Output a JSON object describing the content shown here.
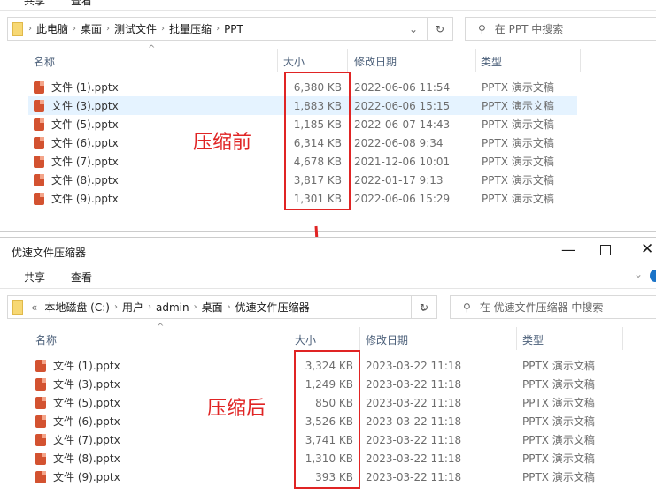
{
  "before": {
    "ribbon": [
      "共享",
      "查看"
    ],
    "breadcrumb": [
      "此电脑",
      "桌面",
      "测试文件",
      "批量压缩",
      "PPT"
    ],
    "search_placeholder": "在 PPT 中搜索",
    "columns": [
      "名称",
      "大小",
      "修改日期",
      "类型"
    ],
    "annotation": "压缩前",
    "files": [
      {
        "name": "文件 (1).pptx",
        "size": "6,380 KB",
        "date": "2022-06-06 11:54",
        "type": "PPTX 演示文稿"
      },
      {
        "name": "文件 (3).pptx",
        "size": "1,883 KB",
        "date": "2022-06-06 15:15",
        "type": "PPTX 演示文稿",
        "selected": true
      },
      {
        "name": "文件 (5).pptx",
        "size": "1,185 KB",
        "date": "2022-06-07 14:43",
        "type": "PPTX 演示文稿"
      },
      {
        "name": "文件 (6).pptx",
        "size": "6,314 KB",
        "date": "2022-06-08 9:34",
        "type": "PPTX 演示文稿"
      },
      {
        "name": "文件 (7).pptx",
        "size": "4,678 KB",
        "date": "2021-12-06 10:01",
        "type": "PPTX 演示文稿"
      },
      {
        "name": "文件 (8).pptx",
        "size": "3,817 KB",
        "date": "2022-01-17 9:13",
        "type": "PPTX 演示文稿"
      },
      {
        "name": "文件 (9).pptx",
        "size": "1,301 KB",
        "date": "2022-06-06 15:29",
        "type": "PPTX 演示文稿"
      }
    ]
  },
  "after": {
    "title": "优速文件压缩器",
    "ribbon": [
      "共享",
      "查看"
    ],
    "breadcrumb": [
      "«",
      "本地磁盘 (C:)",
      "用户",
      "admin",
      "桌面",
      "优速文件压缩器"
    ],
    "search_placeholder": "在 优速文件压缩器 中搜索",
    "columns": [
      "名称",
      "大小",
      "修改日期",
      "类型"
    ],
    "annotation": "压缩后",
    "files": [
      {
        "name": "文件 (1).pptx",
        "size": "3,324 KB",
        "date": "2023-03-22 11:18",
        "type": "PPTX 演示文稿"
      },
      {
        "name": "文件 (3).pptx",
        "size": "1,249 KB",
        "date": "2023-03-22 11:18",
        "type": "PPTX 演示文稿"
      },
      {
        "name": "文件 (5).pptx",
        "size": "850 KB",
        "date": "2023-03-22 11:18",
        "type": "PPTX 演示文稿"
      },
      {
        "name": "文件 (6).pptx",
        "size": "3,526 KB",
        "date": "2023-03-22 11:18",
        "type": "PPTX 演示文稿"
      },
      {
        "name": "文件 (7).pptx",
        "size": "3,741 KB",
        "date": "2023-03-22 11:18",
        "type": "PPTX 演示文稿"
      },
      {
        "name": "文件 (8).pptx",
        "size": "1,310 KB",
        "date": "2023-03-22 11:18",
        "type": "PPTX 演示文稿"
      },
      {
        "name": "文件 (9).pptx",
        "size": "393 KB",
        "date": "2023-03-22 11:18",
        "type": "PPTX 演示文稿"
      }
    ]
  },
  "colors": {
    "accent_red": "#e02424",
    "selection": "#e5f3ff"
  }
}
